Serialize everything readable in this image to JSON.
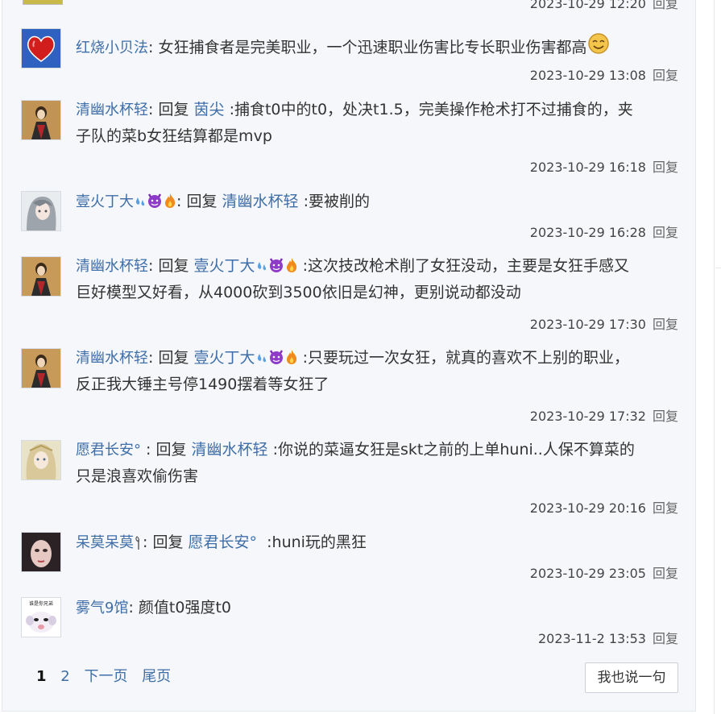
{
  "top_meta": {
    "time": "2023-10-29 12:20",
    "reply": "回复"
  },
  "comments": [
    {
      "user": "红烧小贝法",
      "text": "女狂捕食者是完美职业，一个迅速职业伤害比专长职业伤害都高",
      "time": "2023-10-29 13:08",
      "reply": "回复"
    },
    {
      "user": "清幽水杯轻",
      "reply_prefix": "回复",
      "target": "茵尖",
      "text1": ":捕食t0中的t0，处决t1.5，完美操作枪术打不过捕食的，夹",
      "text2": "子队的菜b女狂结算都是mvp",
      "time": "2023-10-29 16:18",
      "reply": "回复"
    },
    {
      "user": "壹火丁大",
      "reply_prefix": "回复",
      "target": "清幽水杯轻",
      "text1": ":要被削的",
      "time": "2023-10-29 16:28",
      "reply": "回复"
    },
    {
      "user": "清幽水杯轻",
      "reply_prefix": "回复",
      "target": "壹火丁大",
      "text1": ":这次技改枪术削了女狂没动，主要是女狂手感又",
      "text2": "巨好模型又好看，从4000砍到3500依旧是幻神，更别说动都没动",
      "time": "2023-10-29 17:30",
      "reply": "回复"
    },
    {
      "user": "清幽水杯轻",
      "reply_prefix": "回复",
      "target": "壹火丁大",
      "text1": ":只要玩过一次女狂，就真的喜欢不上别的职业，",
      "text2": "反正我大锤主号停1490摆着等女狂了",
      "time": "2023-10-29 17:32",
      "reply": "回复"
    },
    {
      "user": "愿君长安°",
      "reply_prefix": "回复",
      "target": "清幽水杯轻",
      "text1": ":你说的菜逼女狂是skt之前的上单huni..人保不算菜的",
      "text2": "只是浪喜欢偷伤害",
      "time": "2023-10-29 20:16",
      "reply": "回复"
    },
    {
      "user": "呆莫呆莫",
      "reply_prefix": "回复",
      "target": "愿君长安°",
      "text1": ":huni玩的黑狂",
      "time": "2023-10-29 23:05",
      "reply": "回复"
    },
    {
      "user": "雾气9馆",
      "text": "颜值t0强度t0",
      "avatar_caption": "谁是你兄弟",
      "time": "2023-11-2 13:53",
      "reply": "回复"
    }
  ],
  "pager": {
    "current": "1",
    "page2": "2",
    "next": "下一页",
    "last": "尾页"
  },
  "say_button": "我也说一句",
  "colors": {
    "link": "#3f6ea8",
    "panel": "#f5f7fa"
  }
}
